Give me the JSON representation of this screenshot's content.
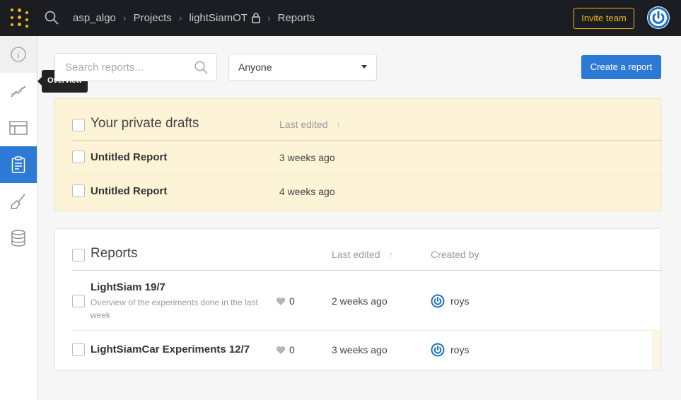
{
  "breadcrumb": {
    "entity": "asp_algo",
    "projects": "Projects",
    "project": "lightSiamOT",
    "page": "Reports"
  },
  "header": {
    "invite_label": "Invite team"
  },
  "sidebar": {
    "items": [
      {
        "icon": "info-icon"
      },
      {
        "icon": "chart-line-icon",
        "tooltip": "Overview"
      },
      {
        "icon": "table-icon"
      },
      {
        "icon": "reports-icon",
        "active": true
      },
      {
        "icon": "sweep-broom-icon"
      },
      {
        "icon": "database-icon"
      }
    ]
  },
  "toolbar": {
    "search_placeholder": "Search reports...",
    "filter_value": "Anyone",
    "create_label": "Create a report"
  },
  "drafts": {
    "title": "Your private drafts",
    "col_last_edited": "Last edited",
    "rows": [
      {
        "title": "Untitled Report",
        "edited": "3 weeks ago"
      },
      {
        "title": "Untitled Report",
        "edited": "4 weeks ago"
      }
    ]
  },
  "reports": {
    "title": "Reports",
    "col_last_edited": "Last edited",
    "col_created_by": "Created by",
    "rows": [
      {
        "title": "LightSiam 19/7",
        "description": "Overview of the experiments done in the last week",
        "likes": "0",
        "edited": "2 weeks ago",
        "author": "roys"
      },
      {
        "title": "LightSiamCar Experiments 12/7",
        "description": "",
        "likes": "0",
        "edited": "3 weeks ago",
        "author": "roys"
      }
    ]
  },
  "colors": {
    "accent": "#2d7ad6",
    "topbar": "#1b1d23",
    "brand_yellow": "#f5b90c",
    "drafts_bg": "#fdf4d7"
  }
}
